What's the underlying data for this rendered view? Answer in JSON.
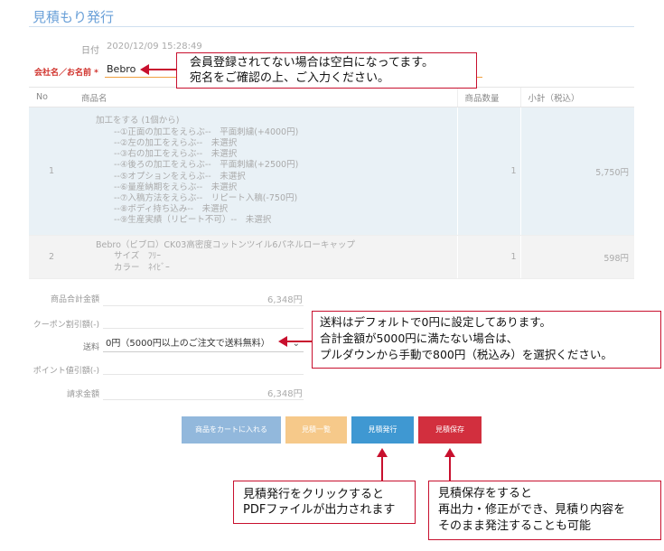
{
  "page": {
    "title": "見積もり発行"
  },
  "form": {
    "date_label": "日付",
    "date_value": "2020/12/09 15:28:49",
    "name_label": "会社名／お名前",
    "required_mark": "*",
    "name_value": "Bebro"
  },
  "table": {
    "headers": {
      "no": "No",
      "name": "商品名",
      "qty": "商品数量",
      "subtotal": "小計（税込）"
    },
    "rows": [
      {
        "no": "1",
        "title": "加工をする (1個から)",
        "options": [
          "--①正面の加工をえらぶ--　平面刺繍(+4000円)",
          "--②左の加工をえらぶ--　未選択",
          "--③右の加工をえらぶ--　未選択",
          "--④後ろの加工をえらぶ--　平面刺繍(+2500円)",
          "--⑤オプションをえらぶ--　未選択",
          "--⑥量産納期をえらぶ--　未選択",
          "--⑦入稿方法をえらぶ--　リピート入稿(-750円)",
          "--⑧ボディ持ち込み--　未選択",
          "--⑨生産実績（リピート不可）--　未選択"
        ],
        "qty": "1",
        "subtotal": "5,750円"
      },
      {
        "no": "2",
        "title": "Bebro（ビブロ）CK03高密度コットンツイル6パネルローキャップ",
        "options": [
          "サイズ　ﾌﾘｰ",
          "カラー　ﾈｲﾋﾞｰ"
        ],
        "qty": "1",
        "subtotal": "598円"
      }
    ]
  },
  "summary": {
    "product_total_label": "商品合計金額",
    "product_total_value": "6,348円",
    "coupon_label": "クーポン割引額(-)",
    "shipping_label": "送料",
    "shipping_value": "0円（5000円以上のご注文で送料無料）",
    "point_label": "ポイント値引額(-)",
    "billing_label": "請求金額",
    "billing_value": "6,348円"
  },
  "buttons": {
    "cart": "商品をカートに入れる",
    "list": "見積一覧",
    "issue": "見積発行",
    "save": "見積保存"
  },
  "callouts": {
    "name_note": [
      "会員登録されてない場合は空白になってます。",
      "宛名をご確認の上、ご入力ください。"
    ],
    "shipping_note": [
      "送料はデフォルトで0円に設定してあります。",
      "合計金額が5000円に満たない場合は、",
      "プルダウンから手動で800円（税込み）を選択ください。"
    ],
    "issue_note": [
      "見積発行をクリックすると",
      "PDFファイルが出力されます"
    ],
    "save_note": [
      "見積保存をすると",
      "再出力・修正ができ、見積り内容を",
      "そのまま発注することも可能"
    ]
  },
  "colors": {
    "accent": "#6aa0d8",
    "cart_button": "#92b8dc",
    "list_button": "#f6c98a",
    "issue_button": "#3f98d2",
    "save_button": "#d22f3e",
    "callout_border": "#c8102e"
  }
}
